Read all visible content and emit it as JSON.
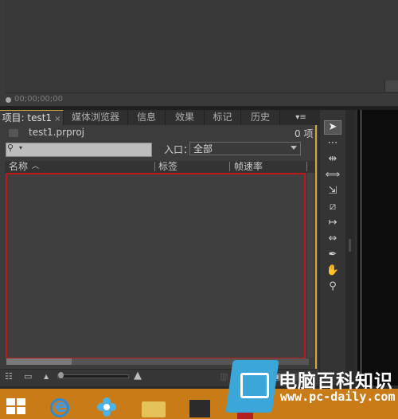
{
  "monitor": {
    "timecode": "00;00;00;00"
  },
  "project_panel": {
    "tabs": [
      {
        "label": "项目: test1",
        "close": "×"
      },
      {
        "label": "媒体浏览器"
      },
      {
        "label": "信息"
      },
      {
        "label": "效果"
      },
      {
        "label": "标记"
      },
      {
        "label": "历史"
      }
    ],
    "tab_menu": "▾≡",
    "project_file": "test1.prproj",
    "item_count": "0 项",
    "search": {
      "placeholder": ""
    },
    "entry_label": "入口：",
    "entry_value": "全部",
    "columns": [
      "名称",
      "标签",
      "帧速率"
    ],
    "sort_indicator": "︿"
  },
  "bottom_toolbar": {
    "icons": [
      "list-view-icon",
      "icon-view-icon",
      "zoom-small-icon",
      "zoom-large-icon",
      "automate-icon",
      "find-icon",
      "new-bin-icon",
      "new-item-icon",
      "delete-icon"
    ]
  },
  "tools": [
    "selection-tool",
    "track-select-tool",
    "ripple-edit-tool",
    "rolling-edit-tool",
    "rate-stretch-tool",
    "razor-tool",
    "slip-tool",
    "slide-tool",
    "pen-tool",
    "hand-tool",
    "zoom-tool"
  ],
  "colors": {
    "accent_border": "#d4a93a",
    "highlight_red": "#c01717",
    "taskbar": "#c97b18",
    "watermark_blue": "#3aa7d8"
  },
  "watermark": {
    "title": "电脑百科知识",
    "url": "www.pc-daily.com"
  }
}
